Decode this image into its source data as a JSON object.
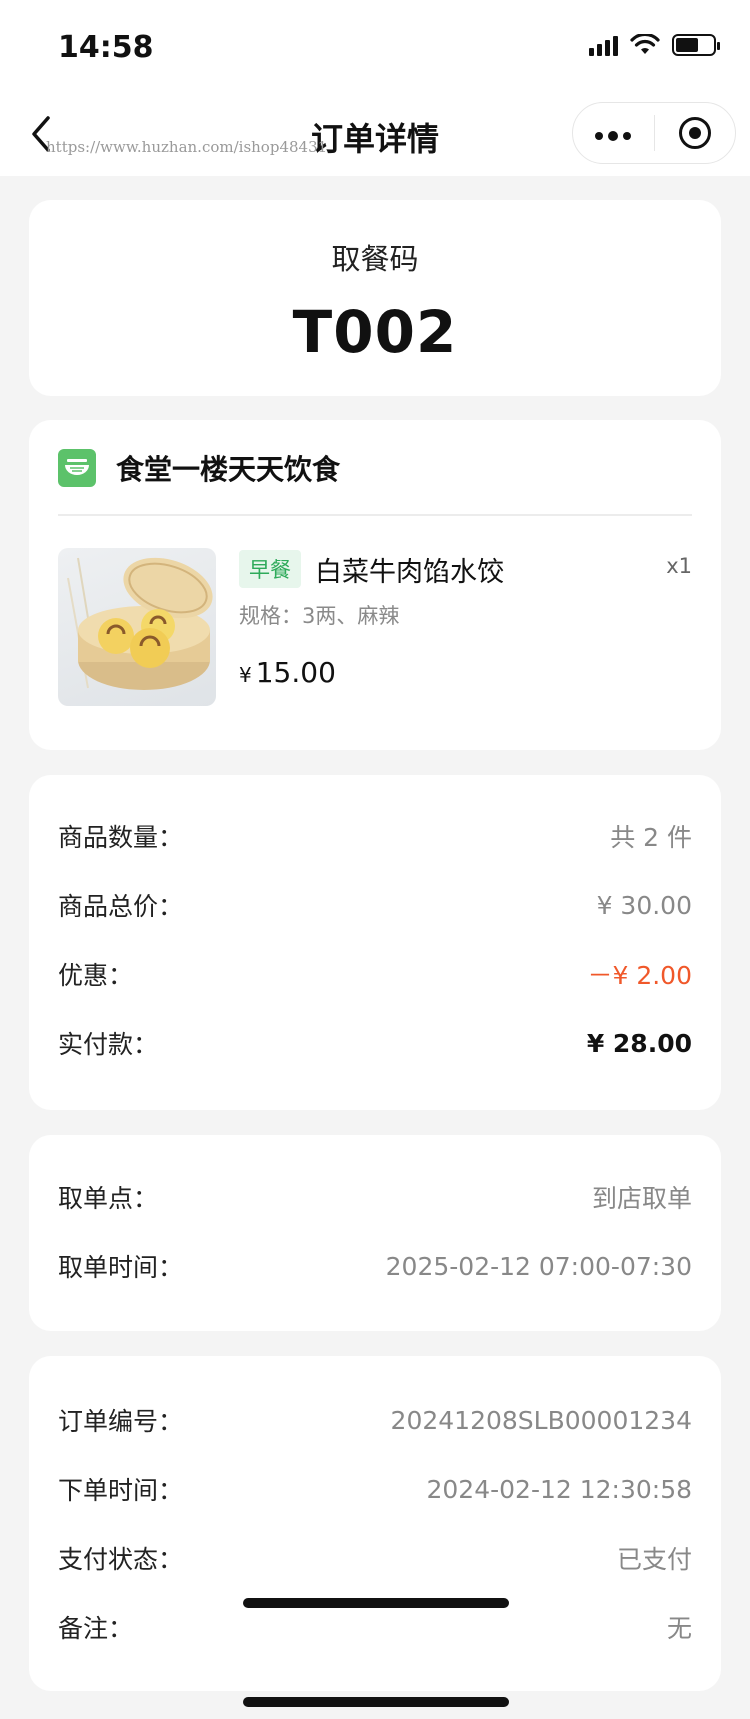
{
  "status": {
    "time": "14:58"
  },
  "nav": {
    "back_icon": "chevron-left-icon",
    "title": "订单详情",
    "watermark": "https://www.huzhan.com/ishop48431",
    "more_icon": "more-dots-icon",
    "close_icon": "target-close-icon"
  },
  "pickup": {
    "label": "取餐码",
    "code": "T002"
  },
  "store": {
    "icon": "bowl-icon",
    "name": "食堂一楼天天饮食",
    "item": {
      "tag": "早餐",
      "name": "白菜牛肉馅水饺",
      "qty": "x1",
      "spec": "规格：3两、麻辣",
      "currency": "¥",
      "price": "15.00"
    }
  },
  "summary": {
    "rows": [
      {
        "label": "商品数量：",
        "value": "共 2 件"
      },
      {
        "label": "商品总价：",
        "value": "¥ 30.00"
      },
      {
        "label": "优惠：",
        "value": "－¥ 2.00"
      },
      {
        "label": "实付款：",
        "value": "¥ 28.00"
      }
    ]
  },
  "pickup_info": {
    "rows": [
      {
        "label": "取单点：",
        "value": "到店取单"
      },
      {
        "label": "取单时间：",
        "value": "2025-02-12 07:00-07:30"
      }
    ]
  },
  "order": {
    "rows": [
      {
        "label": "订单编号：",
        "value": "20241208SLB00001234"
      },
      {
        "label": "下单时间：",
        "value": "2024-02-12 12:30:58"
      },
      {
        "label": "支付状态：",
        "value": "已支付"
      },
      {
        "label": "备注：",
        "value": "无"
      }
    ]
  },
  "colors": {
    "accent_green": "#5cc26a",
    "tag_green": "#2eaa5a",
    "discount_orange": "#f0582a"
  }
}
